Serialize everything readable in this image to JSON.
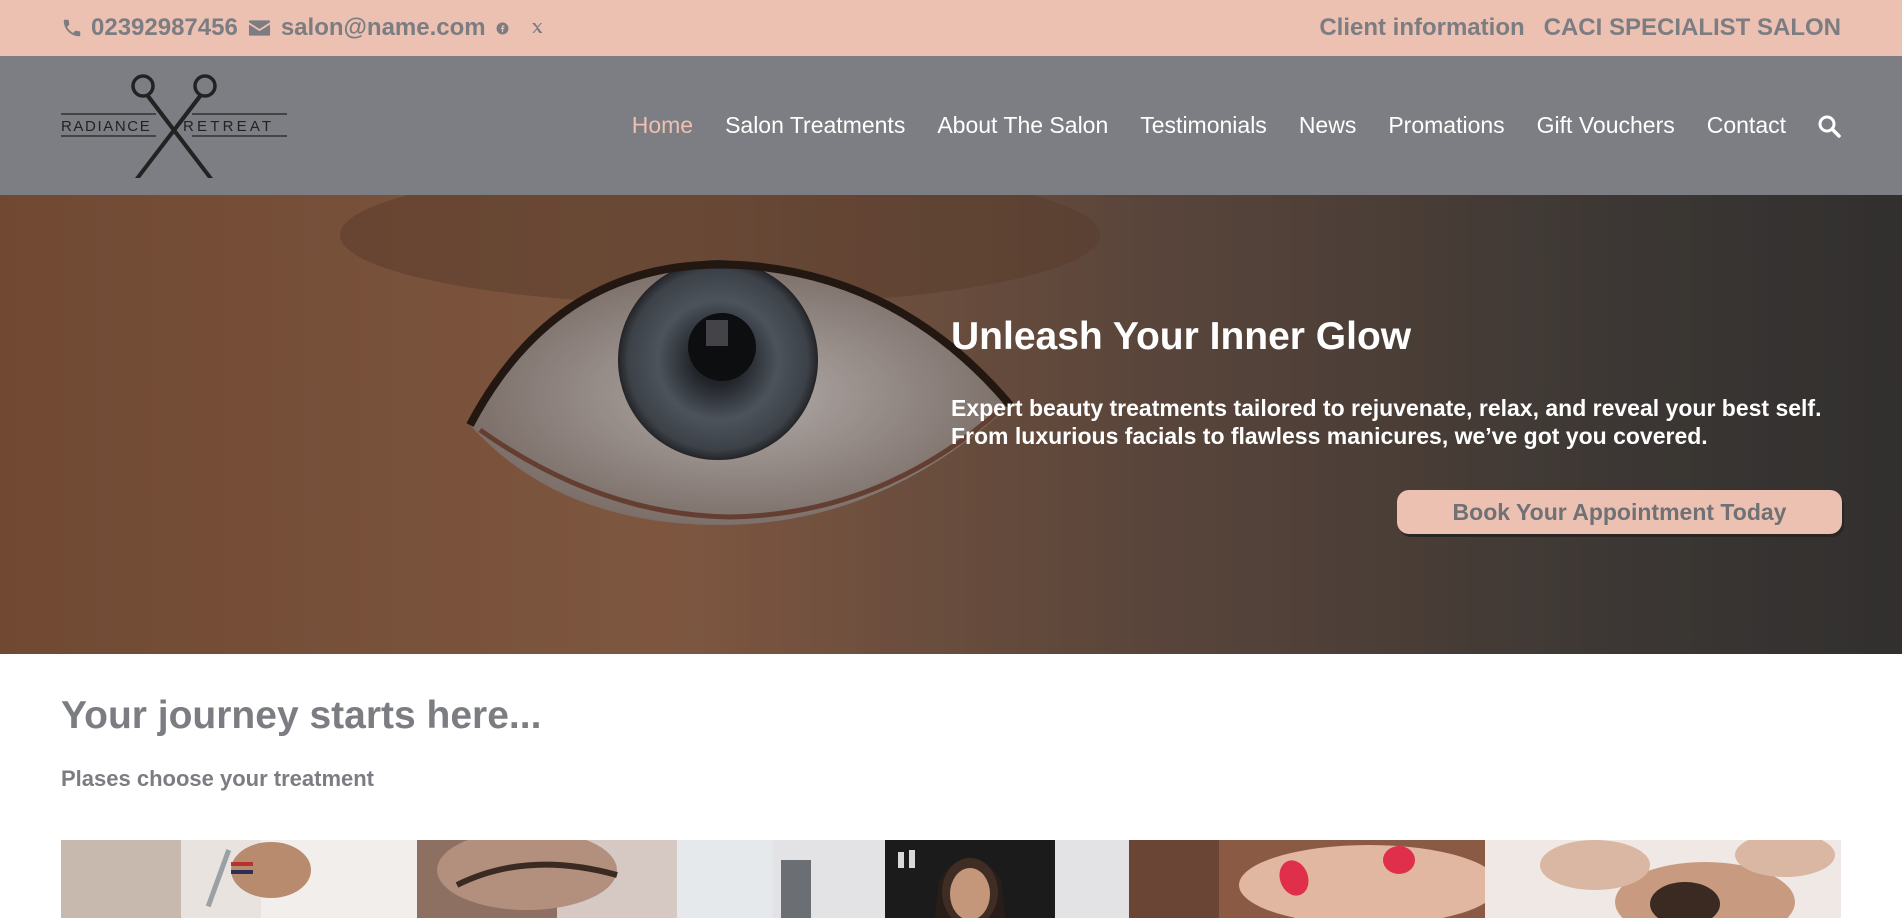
{
  "topbar": {
    "phone": "02392987456",
    "email": "salon@name.com",
    "social_icons": [
      "facebook-icon",
      "x-icon"
    ],
    "links": [
      "Client information",
      "CACI SPECIALIST SALON"
    ]
  },
  "logo": {
    "word_left": "RADIANCE",
    "word_right": "RETREAT"
  },
  "nav": {
    "items": [
      {
        "label": "Home",
        "active": true
      },
      {
        "label": "Salon Treatments",
        "active": false
      },
      {
        "label": "About The Salon",
        "active": false
      },
      {
        "label": "Testimonials",
        "active": false
      },
      {
        "label": "News",
        "active": false
      },
      {
        "label": "Promations",
        "active": false
      },
      {
        "label": "Gift Vouchers",
        "active": false
      },
      {
        "label": "Contact",
        "active": false
      }
    ],
    "search_icon": "search-icon"
  },
  "hero": {
    "title": "Unleash Your Inner Glow",
    "subtitle": "Expert beauty treatments tailored to rejuvenate, relax, and reveal your best self. From luxurious facials to flawless manicures, we’ve got you covered.",
    "cta": "Book Your Appointment Today"
  },
  "content": {
    "title": "Your journey starts here...",
    "subtitle": "Plases choose your treatment"
  },
  "colors": {
    "accent": "#edc1b2",
    "header_bg": "#7c7e83",
    "text_grey": "#7b7d82"
  }
}
